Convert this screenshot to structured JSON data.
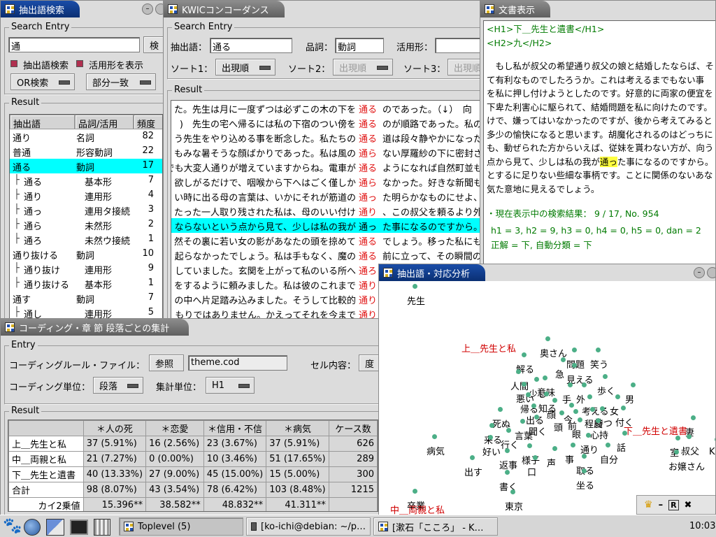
{
  "search_window": {
    "title": "抽出語検索",
    "entry_label": "Search Entry",
    "query": "通",
    "search_button": "検",
    "chk1": "抽出語検索",
    "chk2": "活用形を表示",
    "mode": "OR検索",
    "match": "部分一致",
    "result_label": "Result",
    "headers": [
      "抽出語",
      "品詞/活用",
      "頻度"
    ],
    "rows": [
      {
        "w": "通り",
        "p": "名詞",
        "f": "82",
        "ind": 0
      },
      {
        "w": "普通",
        "p": "形容動詞",
        "f": "22",
        "ind": 0
      },
      {
        "w": "通る",
        "p": "動詞",
        "f": "17",
        "ind": 0,
        "sel": true
      },
      {
        "w": "通る",
        "p": "基本形",
        "f": "7",
        "ind": 1
      },
      {
        "w": "通り",
        "p": "連用形",
        "f": "4",
        "ind": 1
      },
      {
        "w": "通っ",
        "p": "連用タ接続",
        "f": "3",
        "ind": 1
      },
      {
        "w": "通ら",
        "p": "未然形",
        "f": "2",
        "ind": 1
      },
      {
        "w": "通ろ",
        "p": "未然ウ接続",
        "f": "1",
        "ind": 1
      },
      {
        "w": "通り抜ける",
        "p": "動詞",
        "f": "10",
        "ind": 0
      },
      {
        "w": "通り抜け",
        "p": "連用形",
        "f": "9",
        "ind": 1
      },
      {
        "w": "通り抜ける",
        "p": "基本形",
        "f": "1",
        "ind": 1
      },
      {
        "w": "通す",
        "p": "動詞",
        "f": "7",
        "ind": 0
      },
      {
        "w": "通し",
        "p": "連用形",
        "f": "5",
        "ind": 1
      }
    ]
  },
  "kwic_window": {
    "title": "KWICコンコーダンス",
    "entry_label": "Search Entry",
    "word_label": "抽出語：",
    "word": "通る",
    "pos_label": "品詞：",
    "pos": "動詞",
    "conj_label": "活用形：",
    "sort1_label": "ソート1：",
    "sort1": "出現順",
    "sort2_label": "ソート2：",
    "sort2": "出現順",
    "sort3_label": "ソート3：",
    "sort3": "出現順",
    "result_label": "Result",
    "lines": [
      {
        "l": "た。先生は月に一度ずつは必ずこの木の下を",
        "k": "通る",
        "r": "のであった。（↓）　向"
      },
      {
        "l": ")　先生の宅へ帰るには私の下宿のつい傍を",
        "k": "通る",
        "r": "のが順路であった。私の"
      },
      {
        "l": "う先生をやり込める事を断念した。私たちの",
        "k": "通る",
        "r": "道は段々静やかになった"
      },
      {
        "l": "もみな暑そうな顔ばかりであった。私は風の",
        "k": "通ら",
        "r": "ない厚羅紗の下に密封さ"
      },
      {
        "l": "路だけでも大変人通りが増えていますからね。電車が",
        "k": "通る",
        "r": "ようになれば自然町並も"
      },
      {
        "l": "欲しがるだけで、咽喉から下へはごく僅しか",
        "k": "通ら",
        "r": "なかった。好きな新聞も"
      },
      {
        "l": "い時に出る母の言葉は、いかにそれが筋道の",
        "k": "通っ",
        "r": "た明らかなものにせよ、"
      },
      {
        "l": "たった一人取り残された私は、母のいい付け",
        "k": "通り",
        "r": "、この叔父を頼るより外"
      },
      {
        "l": "ならないという点から見て、少しは私の我が",
        "k": "通っ",
        "r": "た事になるのですから。",
        "sel": true
      },
      {
        "l": "然その裏に若い女の影があなたの頭を掠めて",
        "k": "通る",
        "r": "でしょう。移った私にも"
      },
      {
        "l": "起らなかったでしょう。私は手もなく、魔の",
        "k": "通る",
        "r": "前に立って、その瞬間の"
      },
      {
        "l": "していました。玄関を上がって私のいる所へ",
        "k": "通ろ",
        "r": "うとするのです。"
      },
      {
        "l": "をするように頼みました。私は彼のこれまで",
        "k": "通り",
        "r": "の"
      },
      {
        "l": "の中へ片足踏み込みました。そうして比較的",
        "k": "通り",
        "r": ""
      },
      {
        "l": "もりではありません。かえってそれを今まで",
        "k": "通り",
        "r": ""
      }
    ]
  },
  "doc_window": {
    "title": "文書表示",
    "h1": "<H1>下＿先生と遺書</H1>",
    "h2": "<H2>九</H2>",
    "paras": [
      "　もし私が叔父の希望通り叔父の娘と結婚したならば、そ",
      "て有利なものでしたろうか。これは考えるまでもない事",
      "を私に押し付けようとしたのです。好意的に両家の便宜を",
      "下卑た利害心に駆られて、結婚問題を私に向けたのです。",
      "けで、嫌ってはいなかったのですが、後から考えてみると",
      "多少の愉快になると思います。胡魔化されるのはどっちに",
      "も、動ぜられた方からいえば、従妹を貰わない方が、向う",
      "点から見て、少しは私の我が",
      "とするに足りない些細な事柄です。ことに関係のないあな",
      "気た意地に見えるでしょう。"
    ],
    "hl_word": "通っ",
    "hl_after": "た事になるのですから。",
    "info1": "・現在表示中の検索結果：  9 / 17,  No. 954",
    "info2": "h1 = 3,  h2 = 9,  h3 = 0,  h4 = 0,  h5 = 0,  dan = 2",
    "info3": "正解 = 下, 自動分類 = 下"
  },
  "coding_window": {
    "title": "コーディング・章 節 段落ごとの集計",
    "entry_label": "Entry",
    "rule_label": "コーディングルール・ファイル：",
    "ref_button": "参照",
    "rule_file": "theme.cod",
    "cell_label": "セル内容：",
    "cell_value": "度",
    "unit_label": "コーディング単位：",
    "unit": "段落",
    "agg_label": "集計単位：",
    "agg": "H1",
    "result_label": "Result",
    "headers": [
      "",
      "＊人の死",
      "＊恋愛",
      "＊信用・不信",
      "＊病気",
      "ケース数"
    ],
    "rows": [
      [
        "上＿先生と私",
        "37  (5.91%)",
        "16  (2.56%)",
        "23  (3.67%)",
        "37  (5.91%)",
        "626"
      ],
      [
        "中＿両親と私",
        "21  (7.27%)",
        "0   (0.00%)",
        "10  (3.46%)",
        "51  (17.65%)",
        "289"
      ],
      [
        "下＿先生と遺書",
        "40  (13.33%)",
        "27  (9.00%)",
        "45  (15.00%)",
        "15  (5.00%)",
        "300"
      ],
      [
        "合計",
        "98  (8.07%)",
        "43  (3.54%)",
        "78  (6.42%)",
        "103  (8.48%)",
        "1215"
      ],
      [
        "カイ2乗値",
        "15.396**",
        "38.582**",
        "48.832**",
        "41.311**",
        ""
      ]
    ]
  },
  "ca_window": {
    "title": "抽出語・対応分析",
    "words": [
      "先生",
      "奥さん",
      "問題",
      "笑う",
      "解る",
      "急",
      "見える",
      "人間",
      "意味",
      "歩く",
      "男",
      "悪い",
      "少し",
      "帰る",
      "知る",
      "手",
      "外",
      "考える",
      "女",
      "出る",
      "顔",
      "今",
      "持つ",
      "付く",
      "死ぬ",
      "頭",
      "前",
      "程度",
      "聞く",
      "言葉",
      "眼",
      "心持",
      "来る",
      "行く",
      "通り",
      "話",
      "病気",
      "好い",
      "様子",
      "自分",
      "声",
      "事",
      "取る",
      "返事",
      "口",
      "出す",
      "書く",
      "坐る",
      "卒業",
      "東京",
      "妻",
      "室",
      "叔父",
      "お嬢さん",
      "K"
    ],
    "red_labels": [
      "上＿先生と私",
      "下＿先生と遺書",
      "中＿両親と私"
    ]
  },
  "taskbar": {
    "items": [
      "Toplevel (5)",
      "[ko-ichi@debian: ~/p…",
      "[漱石「こころ」 - K…"
    ],
    "clock": "10:03"
  },
  "colors": {
    "accent": "#0a2f73",
    "keyword": "#e01010",
    "highlight": "#00ffff",
    "green_text": "#007a00",
    "red_label": "#d00000"
  }
}
